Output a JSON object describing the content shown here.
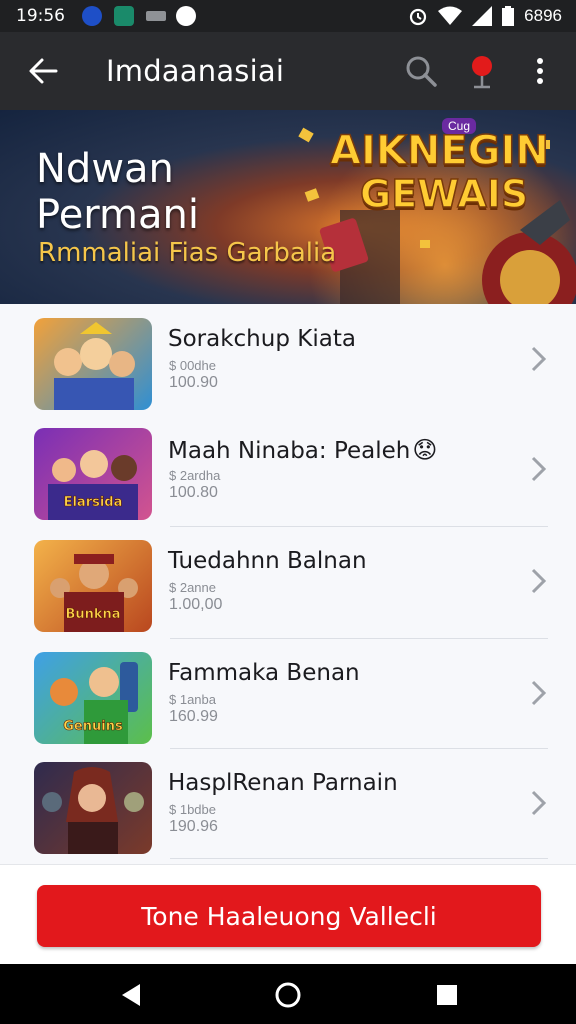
{
  "status_bar": {
    "time": "19:56",
    "battery_text": "6896"
  },
  "app_bar": {
    "title": "Imdaanasiai"
  },
  "banner": {
    "headline_line1": "Ndwan",
    "headline_line2": "Permani",
    "subheading": "Rmmaliai Fias Garbalia",
    "logo_line1": "AIKNEGIN",
    "logo_line2": "GEWAIS",
    "logo_tag": "Cug"
  },
  "games": [
    {
      "name": "Sorakchup Kiata",
      "meta1": "$ 00dhe",
      "meta2": "100.90",
      "thumb_caption": "",
      "colors": [
        "#f2a13a",
        "#2f8fd3"
      ]
    },
    {
      "name": "Maah Ninaba: Pealeh",
      "meta1": "$ 2ardha",
      "meta2": "100.80",
      "thumb_caption": "Elarsida",
      "colors": [
        "#7a2fb5",
        "#d2548f"
      ]
    },
    {
      "name": "Tuedahnn Balnan",
      "meta1": "$ 2anne",
      "meta2": "1.00,00",
      "thumb_caption": "Bunkna",
      "colors": [
        "#f3b24a",
        "#b9471f"
      ]
    },
    {
      "name": "Fammaka Benan",
      "meta1": "$ 1anba",
      "meta2": "160.99",
      "thumb_caption": "Genuins",
      "colors": [
        "#3fa0e6",
        "#5cbf4a"
      ]
    },
    {
      "name": "HasplRenan Parnain",
      "meta1": "$ 1bdbe",
      "meta2": "190.96",
      "thumb_caption": "",
      "colors": [
        "#2f2b4e",
        "#7b3a2a"
      ]
    }
  ],
  "emoji": "😟",
  "cta_label": "Tone Haaleuong Vallecli"
}
